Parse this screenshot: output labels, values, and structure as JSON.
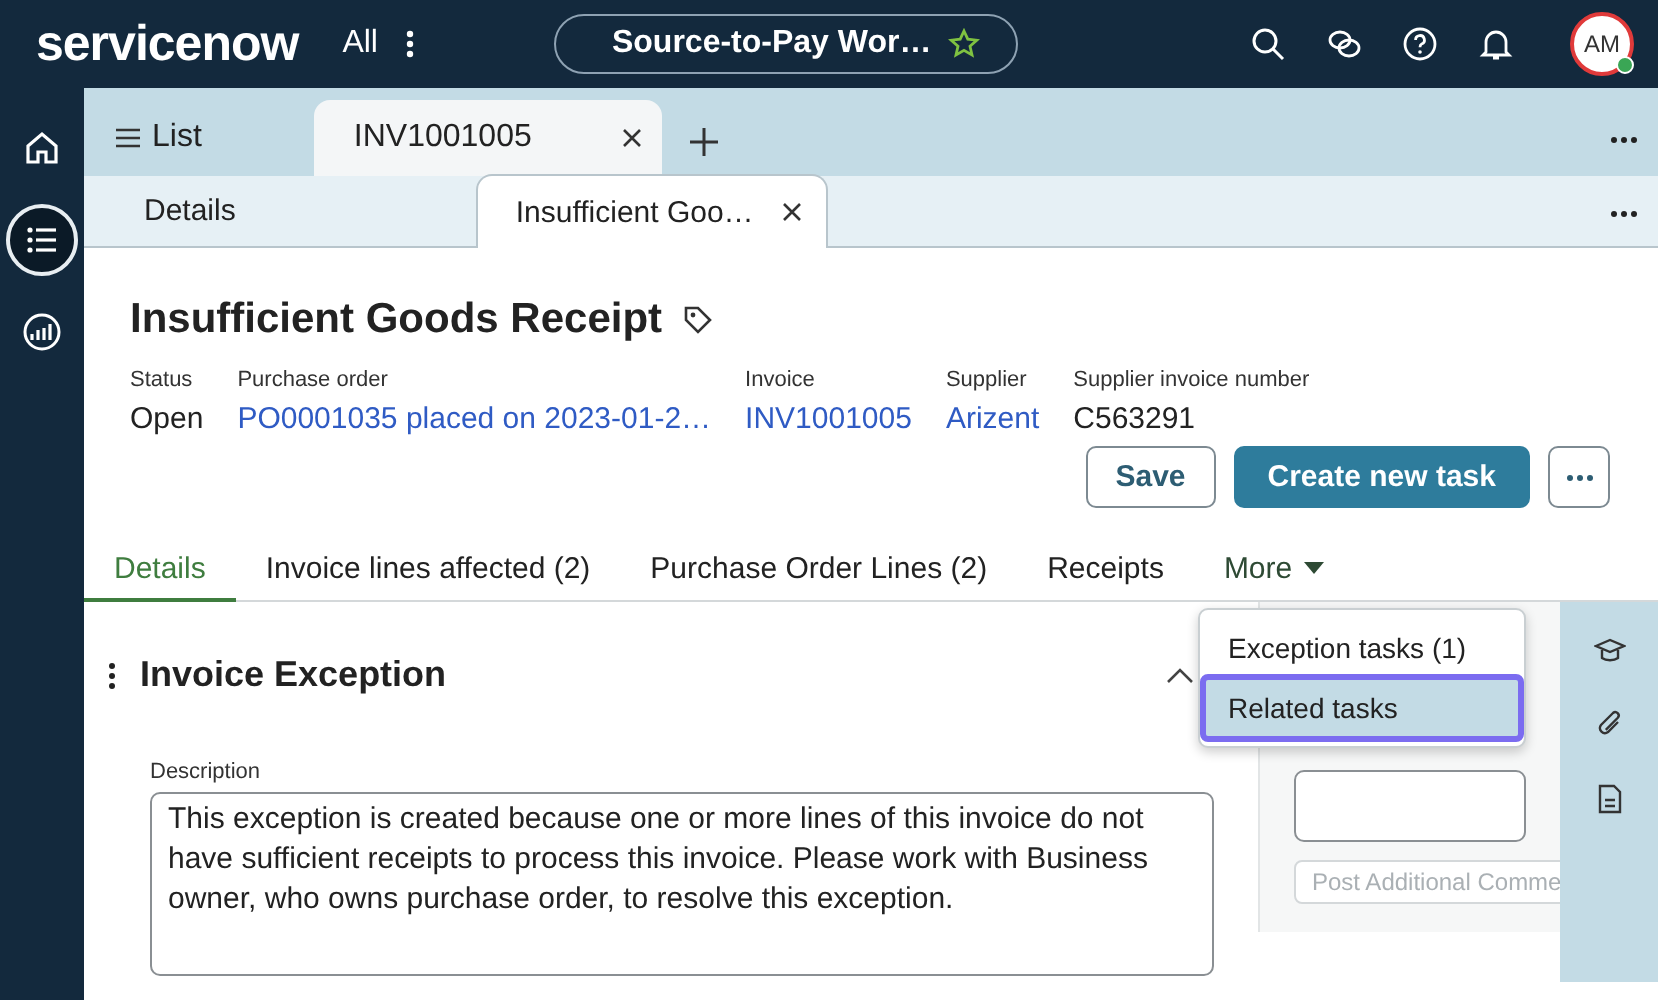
{
  "header": {
    "logo": "servicenow",
    "all": "All",
    "workspace": "Source-to-Pay Wor…",
    "avatar": "AM"
  },
  "rail": [
    {
      "kind": "home",
      "selected": false
    },
    {
      "kind": "list",
      "selected": true
    },
    {
      "kind": "analytics",
      "selected": false
    }
  ],
  "tabs": [
    {
      "label": "List",
      "kind": "list",
      "selected": false
    },
    {
      "label": "INV1001005",
      "kind": "record",
      "selected": true
    }
  ],
  "subtabs": [
    {
      "label": "Details",
      "selected": false
    },
    {
      "label": "Insufficient Goo…",
      "selected": true
    }
  ],
  "record": {
    "title": "Insufficient Goods Receipt",
    "fields": [
      {
        "label": "Status",
        "value": "Open",
        "kind": "text"
      },
      {
        "label": "Purchase order",
        "value": "PO0001035 placed on 2023-01-2…",
        "kind": "link"
      },
      {
        "label": "Invoice",
        "value": "INV1001005",
        "kind": "link"
      },
      {
        "label": "Supplier",
        "value": "Arizent",
        "kind": "link"
      },
      {
        "label": "Supplier invoice number",
        "value": "C563291",
        "kind": "text"
      }
    ],
    "actions": [
      {
        "label": "Save",
        "kind": "secondary"
      },
      {
        "label": "Create new task",
        "kind": "primary"
      },
      {
        "kind": "more"
      }
    ]
  },
  "record_tabs": [
    {
      "label": "Details",
      "selected": true,
      "kind": "tab"
    },
    {
      "label": "Invoice lines affected (2)",
      "selected": false,
      "kind": "tab"
    },
    {
      "label": "Purchase Order Lines (2)",
      "selected": false,
      "kind": "tab"
    },
    {
      "label": "Receipts",
      "selected": false,
      "kind": "tab"
    },
    {
      "label": "More",
      "selected": false,
      "kind": "dropdown"
    }
  ],
  "dropdown": {
    "items": [
      {
        "label": "Exception tasks (1)",
        "selected": false
      },
      {
        "label": "Related tasks",
        "selected": true
      }
    ]
  },
  "section": {
    "title": "Invoice Exception",
    "expanded": true,
    "description_label": "Description",
    "description": "This exception is created because one or more lines of this invoice do not have sufficient receipts to process this invoice. Please work with Business owner, who owns purchase order, to resolve this exception."
  },
  "activity": {
    "post_button": "Post Additional Comme"
  }
}
